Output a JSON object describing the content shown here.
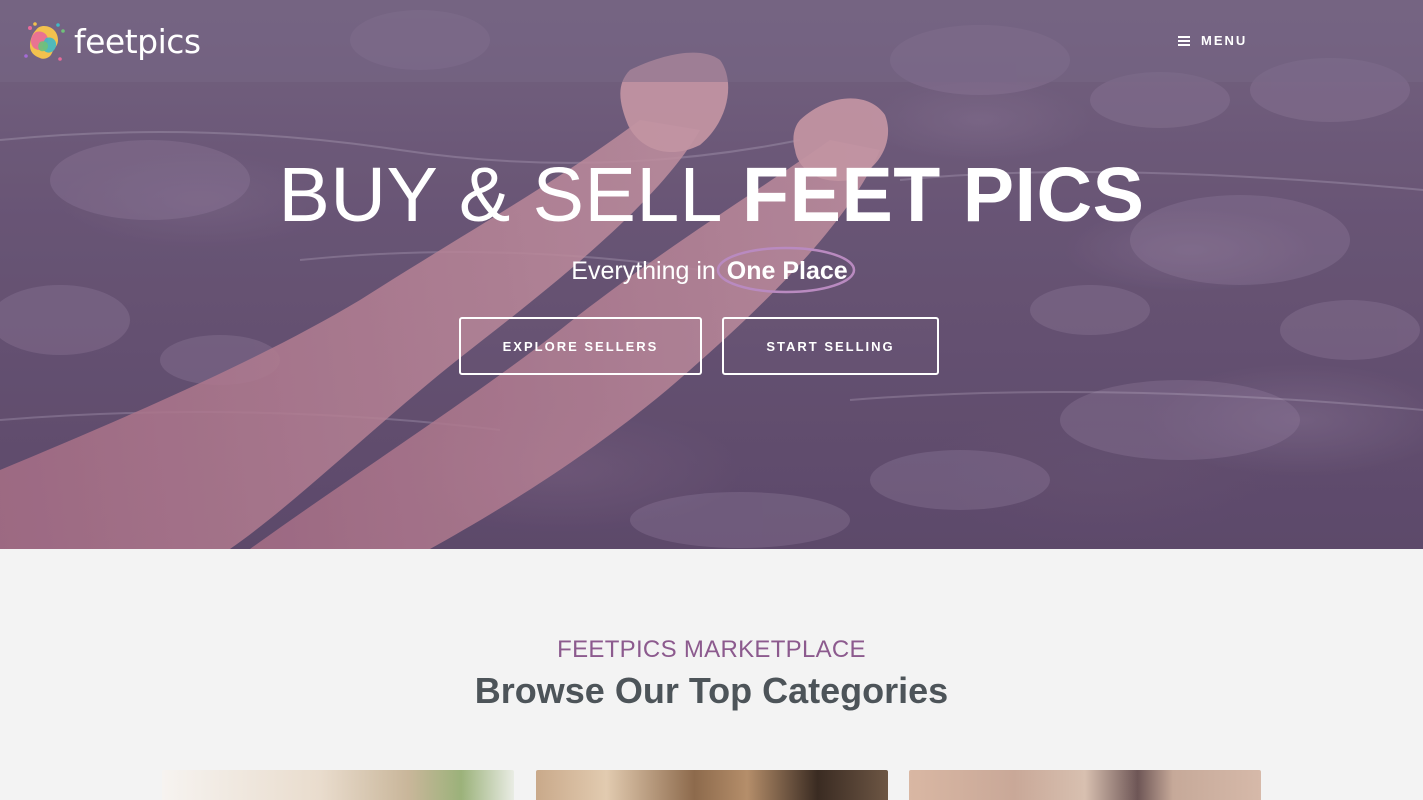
{
  "header": {
    "logo_text": "feetpics",
    "logo_icon": "multicolor-feet-logo-icon",
    "menu_label": "MENU",
    "menu_icon": "hamburger-icon"
  },
  "hero": {
    "headline_light": "BUY & SELL",
    "headline_bold": "FEET PICS",
    "subline_prefix": "Everything in",
    "subline_highlight": "One Place",
    "highlight_color": "#b98ac0",
    "buttons": {
      "explore": "EXPLORE SELLERS",
      "start": "START SELLING"
    }
  },
  "categories": {
    "eyebrow": "FEETPICS MARKETPLACE",
    "title": "Browse Our Top Categories",
    "eyebrow_color": "#8c5a8e",
    "title_color": "#4d5459"
  }
}
